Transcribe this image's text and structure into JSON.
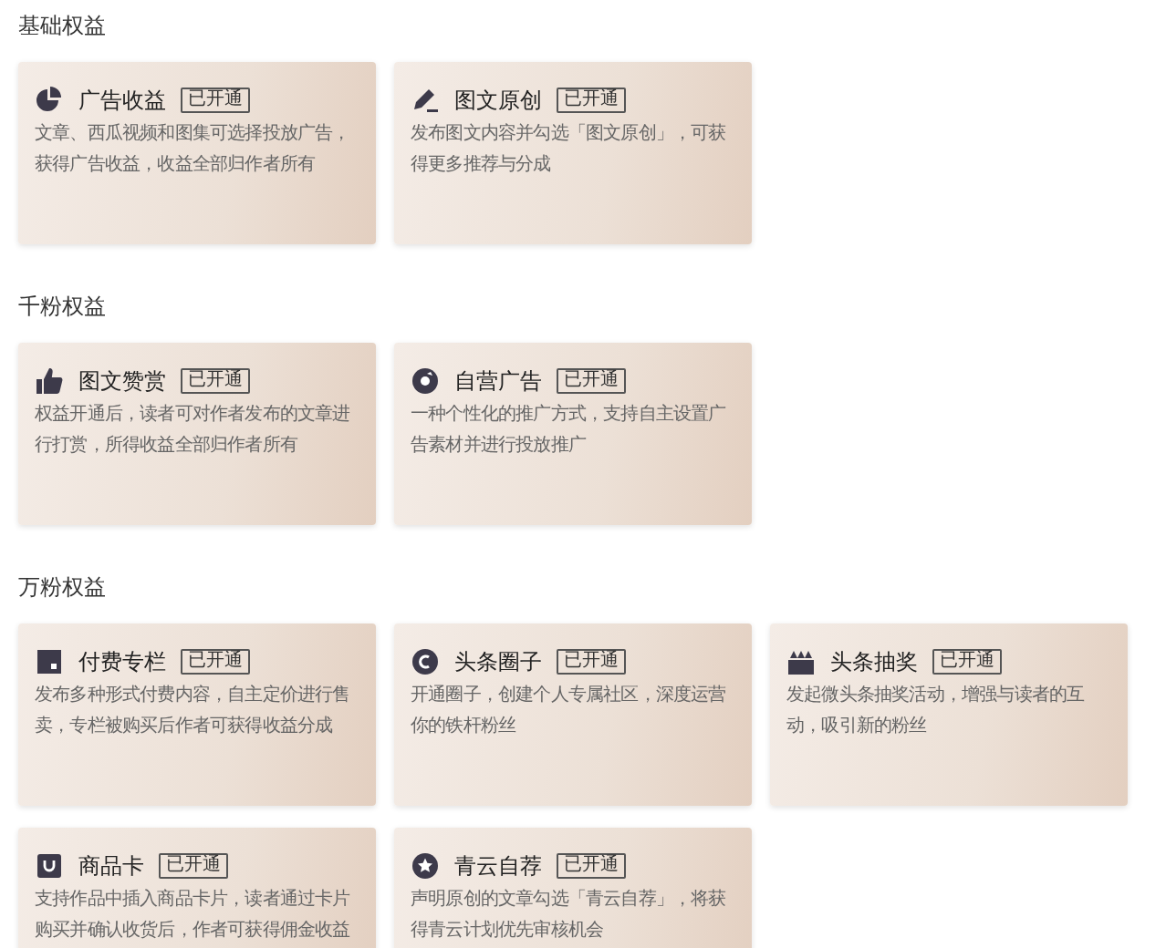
{
  "sections": [
    {
      "title": "基础权益",
      "cards": [
        {
          "title": "广告收益",
          "badge": "已开通",
          "description": "文章、西瓜视频和图集可选择投放广告，获得广告收益，收益全部归作者所有"
        },
        {
          "title": "图文原创",
          "badge": "已开通",
          "description": "发布图文内容并勾选「图文原创」，可获得更多推荐与分成"
        }
      ]
    },
    {
      "title": "千粉权益",
      "cards": [
        {
          "title": "图文赞赏",
          "badge": "已开通",
          "description": "权益开通后，读者可对作者发布的文章进行打赏，所得收益全部归作者所有"
        },
        {
          "title": "自营广告",
          "badge": "已开通",
          "description": "一种个性化的推广方式，支持自主设置广告素材并进行投放推广"
        }
      ]
    },
    {
      "title": "万粉权益",
      "cards": [
        {
          "title": "付费专栏",
          "badge": "已开通",
          "description": "发布多种形式付费内容，自主定价进行售卖，专栏被购买后作者可获得收益分成"
        },
        {
          "title": "头条圈子",
          "badge": "已开通",
          "description": "开通圈子，创建个人专属社区，深度运营你的铁杆粉丝"
        },
        {
          "title": "头条抽奖",
          "badge": "已开通",
          "description": "发起微头条抽奖活动，增强与读者的互动，吸引新的粉丝"
        },
        {
          "title": "商品卡",
          "badge": "已开通",
          "description": "支持作品中插入商品卡片，读者通过卡片购买并确认收货后，作者可获得佣金收益"
        },
        {
          "title": "青云自荐",
          "badge": "已开通",
          "description": "声明原创的文章勾选「青云自荐」，将获得青云计划优先审核机会"
        }
      ]
    }
  ]
}
